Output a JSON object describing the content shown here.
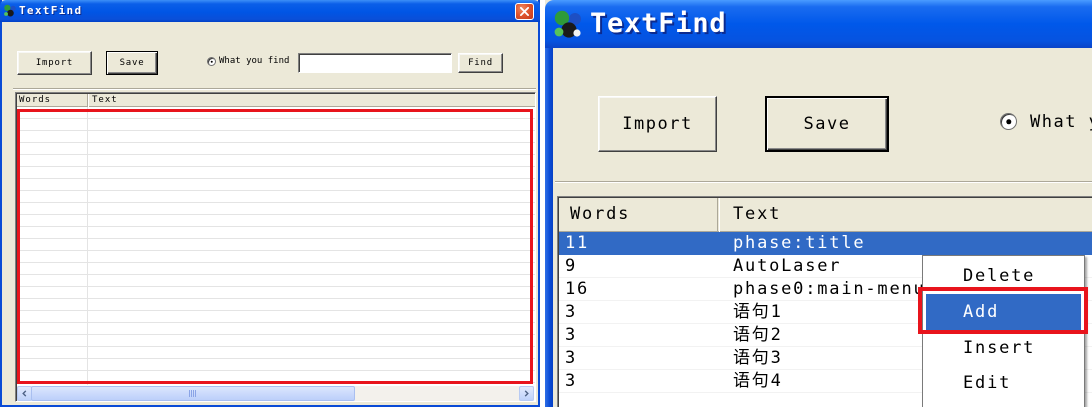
{
  "app": {
    "title": "TextFind",
    "import_label": "Import",
    "save_label": "Save",
    "find_label": "Find",
    "radio_label": "What you find",
    "radio_checked": true,
    "search_value": "",
    "columns": {
      "words": "Words",
      "text": "Text"
    }
  },
  "zoom_list": {
    "rows": [
      {
        "words": "11",
        "text": "phase:title",
        "selected": true
      },
      {
        "words": "9",
        "text": "AutoLaser",
        "selected": false
      },
      {
        "words": "16",
        "text": "phase0:main-menu",
        "selected": false
      },
      {
        "words": "3",
        "text": "语句1",
        "selected": false
      },
      {
        "words": "3",
        "text": "语句2",
        "selected": false
      },
      {
        "words": "3",
        "text": "语句3",
        "selected": false
      },
      {
        "words": "3",
        "text": "语句4",
        "selected": false
      }
    ]
  },
  "context_menu": {
    "items": [
      {
        "label": "Delete",
        "highlighted": false
      },
      {
        "label": "Add",
        "highlighted": true
      },
      {
        "label": "Insert",
        "highlighted": false
      },
      {
        "label": "Edit",
        "highlighted": false
      }
    ]
  },
  "annotations": {
    "highlight_color": "#e8141c"
  },
  "colors": {
    "titlebar": "#0055e5",
    "window_body": "#ece9d8",
    "selection": "#316ac5",
    "close_button": "#e0552e"
  },
  "icons": [
    "app-icon",
    "close-icon",
    "radio-icon",
    "chevron-left-icon",
    "chevron-right-icon"
  ]
}
